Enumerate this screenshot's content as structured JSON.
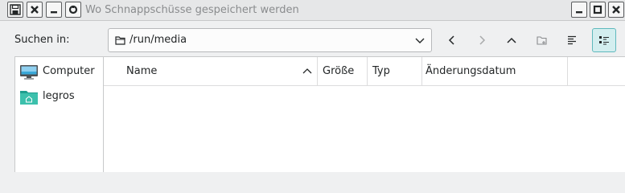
{
  "window": {
    "title": "Wo Schnappschüsse gespeichert werden"
  },
  "toolbar": {
    "look_in_label": "Suchen in:",
    "path": "/run/media",
    "buttons": {
      "back": "chevron-left-icon",
      "forward": "chevron-right-icon",
      "up": "chevron-up-icon",
      "new_folder": "new-folder-icon",
      "list_view": "list-view-icon",
      "detail_view": "detail-view-icon"
    },
    "accent_color": "#5fb9bd"
  },
  "sidebar": {
    "items": [
      {
        "label": "Computer",
        "icon": "computer-icon"
      },
      {
        "label": "legros",
        "icon": "home-folder-icon"
      }
    ]
  },
  "file_view": {
    "columns": [
      {
        "label": "Name",
        "sorted": "ascending"
      },
      {
        "label": "Größe"
      },
      {
        "label": "Typ"
      },
      {
        "label": "Änderungsdatum"
      }
    ],
    "rows": []
  }
}
